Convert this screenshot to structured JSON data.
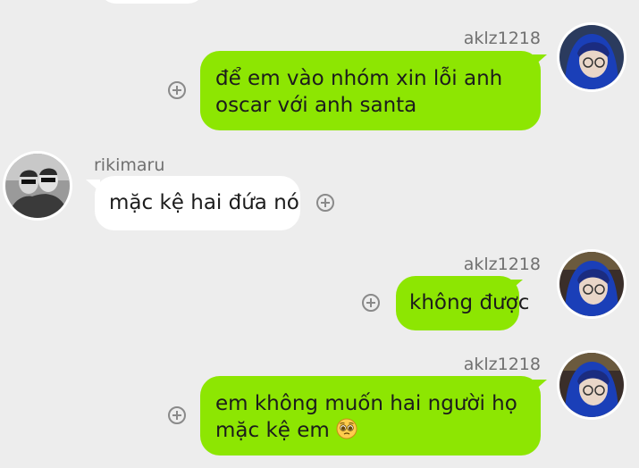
{
  "messages": [
    {
      "sender": "aklz1218",
      "side": "right",
      "lines": [
        "để em vào nhóm xin lỗi anh",
        "oscar với anh santa"
      ]
    },
    {
      "sender": "rikimaru",
      "side": "left",
      "lines": [
        "mặc kệ hai đứa nó"
      ]
    },
    {
      "sender": "aklz1218",
      "side": "right",
      "lines": [
        "không được"
      ]
    },
    {
      "sender": "aklz1218",
      "side": "right",
      "lines": [
        "em không muốn hai người họ",
        "mặc kệ em"
      ],
      "trailing_icon": "pleading-face-emoji"
    }
  ],
  "colors": {
    "background": "#ededed",
    "own_bubble": "#8de602",
    "other_bubble": "#ffffff",
    "name_text": "#707070",
    "attach_icon": "#8a8a8a"
  },
  "icons": {
    "attach": "plus-circle-icon"
  }
}
